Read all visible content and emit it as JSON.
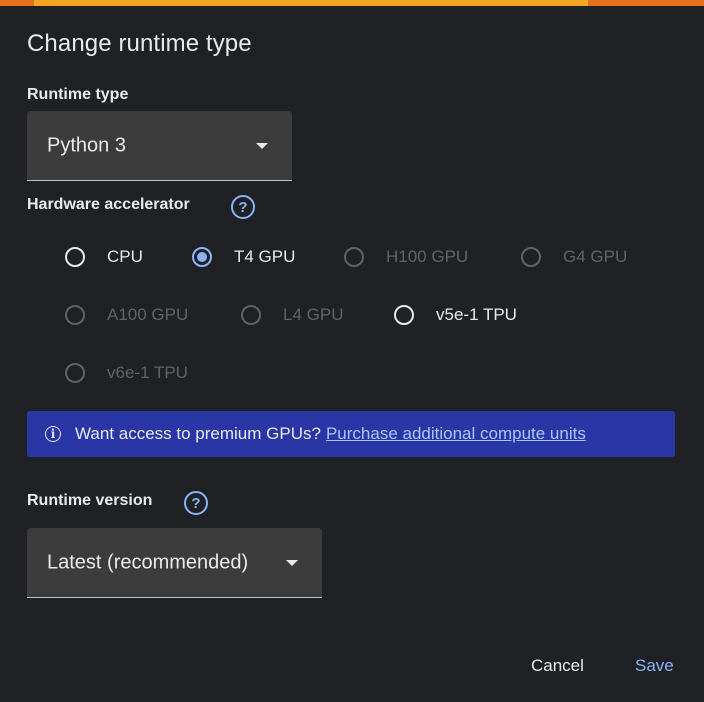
{
  "dialog": {
    "title": "Change runtime type",
    "accent_colors": {
      "top_bar": "#f4a524",
      "top_bar_edge": "#e4711e",
      "selected": "#8ab4f8",
      "banner": "#2b36a6"
    }
  },
  "runtime_type": {
    "label": "Runtime type",
    "selected": "Python 3"
  },
  "hardware_accelerator": {
    "label": "Hardware accelerator",
    "help_icon": "help-circle-icon",
    "options": [
      {
        "label": "CPU",
        "state": "enabled"
      },
      {
        "label": "T4 GPU",
        "state": "selected"
      },
      {
        "label": "H100 GPU",
        "state": "disabled"
      },
      {
        "label": "G4 GPU",
        "state": "disabled"
      },
      {
        "label": "A100 GPU",
        "state": "disabled"
      },
      {
        "label": "L4 GPU",
        "state": "disabled"
      },
      {
        "label": "v5e-1 TPU",
        "state": "enabled"
      },
      {
        "label": "v6e-1 TPU",
        "state": "disabled"
      }
    ]
  },
  "banner": {
    "icon": "info-icon",
    "text": "Want access to premium GPUs?",
    "link": "Purchase additional compute units"
  },
  "runtime_version": {
    "label": "Runtime version",
    "help_icon": "help-circle-icon",
    "selected": "Latest (recommended)"
  },
  "actions": {
    "cancel": "Cancel",
    "save": "Save"
  }
}
